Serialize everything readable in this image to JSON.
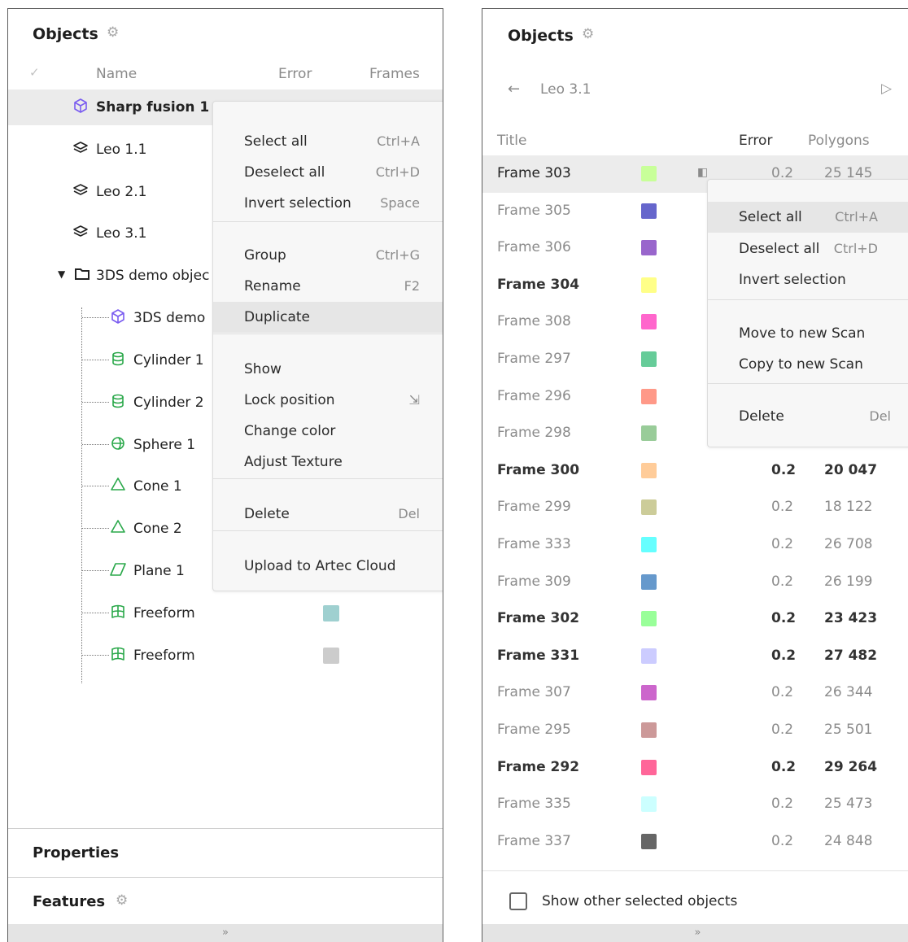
{
  "left": {
    "title": "Objects",
    "columns": {
      "check": "✓",
      "name": "Name",
      "error": "Error",
      "frames": "Frames"
    },
    "tree": [
      {
        "label": "Sharp fusion 1",
        "icon": "cube-icon",
        "bold": true
      },
      {
        "label": "Leo 1.1",
        "icon": "layers-icon"
      },
      {
        "label": "Leo 2.1",
        "icon": "layers-icon"
      },
      {
        "label": "Leo 3.1",
        "icon": "layers-icon"
      },
      {
        "label": "3DS demo objec",
        "icon": "folder-icon"
      },
      {
        "label": "3DS demo",
        "icon": "cube-icon"
      },
      {
        "label": "Cylinder 1",
        "icon": "cylinder-icon"
      },
      {
        "label": "Cylinder 2",
        "icon": "cylinder-icon"
      },
      {
        "label": "Sphere 1",
        "icon": "sphere-icon"
      },
      {
        "label": "Cone 1",
        "icon": "cone-icon"
      },
      {
        "label": "Cone 2",
        "icon": "cone-icon"
      },
      {
        "label": "Plane 1",
        "icon": "plane-icon"
      },
      {
        "label": "Freeform",
        "icon": "freeform-icon",
        "swatch": "#9fd0d0"
      },
      {
        "label": "Freeform",
        "icon": "freeform-icon",
        "swatch": "#cccccc"
      }
    ],
    "menu": {
      "items": [
        {
          "label": "Select all",
          "shortcut": "Ctrl+A"
        },
        {
          "label": "Deselect all",
          "shortcut": "Ctrl+D"
        },
        {
          "label": "Invert selection",
          "shortcut": "Space"
        },
        {
          "label": "Group",
          "shortcut": "Ctrl+G"
        },
        {
          "label": "Rename",
          "shortcut": "F2"
        },
        {
          "label": "Duplicate",
          "shortcut": ""
        },
        {
          "label": "Show",
          "shortcut": ""
        },
        {
          "label": "Lock position",
          "shortcut": "⇲"
        },
        {
          "label": "Change color",
          "shortcut": ""
        },
        {
          "label": "Adjust Texture",
          "shortcut": ""
        },
        {
          "label": "Delete",
          "shortcut": "Del"
        },
        {
          "label": "Upload to Artec Cloud",
          "shortcut": ""
        }
      ]
    },
    "properties": "Properties",
    "features": "Features",
    "expand": "»"
  },
  "right": {
    "title": "Objects",
    "breadcrumb": "Leo 3.1",
    "columns": {
      "title": "Title",
      "error": "Error",
      "polygons": "Polygons"
    },
    "frames": [
      {
        "title": "Frame 303",
        "color": "#c8ff99",
        "error": "0.2",
        "polygons": "25 145",
        "bold": false,
        "selected": true
      },
      {
        "title": "Frame 305",
        "color": "#6666cc",
        "error": "",
        "polygons": "",
        "bold": false
      },
      {
        "title": "Frame 306",
        "color": "#9966cc",
        "error": "",
        "polygons": "",
        "bold": false
      },
      {
        "title": "Frame 304",
        "color": "#ffff88",
        "error": "",
        "polygons": "",
        "bold": true
      },
      {
        "title": "Frame 308",
        "color": "#ff66cc",
        "error": "",
        "polygons": "",
        "bold": false
      },
      {
        "title": "Frame 297",
        "color": "#66cc99",
        "error": "",
        "polygons": "",
        "bold": false
      },
      {
        "title": "Frame 296",
        "color": "#ff9988",
        "error": "",
        "polygons": "",
        "bold": false
      },
      {
        "title": "Frame 298",
        "color": "#99cc99",
        "error": "",
        "polygons": "",
        "bold": false
      },
      {
        "title": "Frame 300",
        "color": "#ffcc99",
        "error": "0.2",
        "polygons": "20 047",
        "bold": true
      },
      {
        "title": "Frame 299",
        "color": "#cccc99",
        "error": "0.2",
        "polygons": "18 122",
        "bold": false
      },
      {
        "title": "Frame 333",
        "color": "#66ffff",
        "error": "0.2",
        "polygons": "26 708",
        "bold": false
      },
      {
        "title": "Frame 309",
        "color": "#6699cc",
        "error": "0.2",
        "polygons": "26 199",
        "bold": false
      },
      {
        "title": "Frame 302",
        "color": "#99ff99",
        "error": "0.2",
        "polygons": "23 423",
        "bold": true
      },
      {
        "title": "Frame 331",
        "color": "#ccccff",
        "error": "0.2",
        "polygons": "27 482",
        "bold": true
      },
      {
        "title": "Frame 307",
        "color": "#cc66cc",
        "error": "0.2",
        "polygons": "26 344",
        "bold": false
      },
      {
        "title": "Frame 295",
        "color": "#cc9999",
        "error": "0.2",
        "polygons": "25 501",
        "bold": false
      },
      {
        "title": "Frame 292",
        "color": "#ff6699",
        "error": "0.2",
        "polygons": "29 264",
        "bold": true
      },
      {
        "title": "Frame 335",
        "color": "#ccffff",
        "error": "0.2",
        "polygons": "25 473",
        "bold": false
      },
      {
        "title": "Frame 337",
        "color": "#666666",
        "error": "0.2",
        "polygons": "24 848",
        "bold": false
      }
    ],
    "menu": {
      "items": [
        {
          "label": "Select all",
          "shortcut": "Ctrl+A"
        },
        {
          "label": "Deselect all",
          "shortcut": "Ctrl+D"
        },
        {
          "label": "Invert selection",
          "shortcut": ""
        },
        {
          "label": "Move to new Scan",
          "shortcut": ""
        },
        {
          "label": "Copy to new Scan",
          "shortcut": ""
        },
        {
          "label": "Delete",
          "shortcut": "Del"
        }
      ]
    },
    "show_other": "Show other selected objects",
    "expand": "»"
  }
}
